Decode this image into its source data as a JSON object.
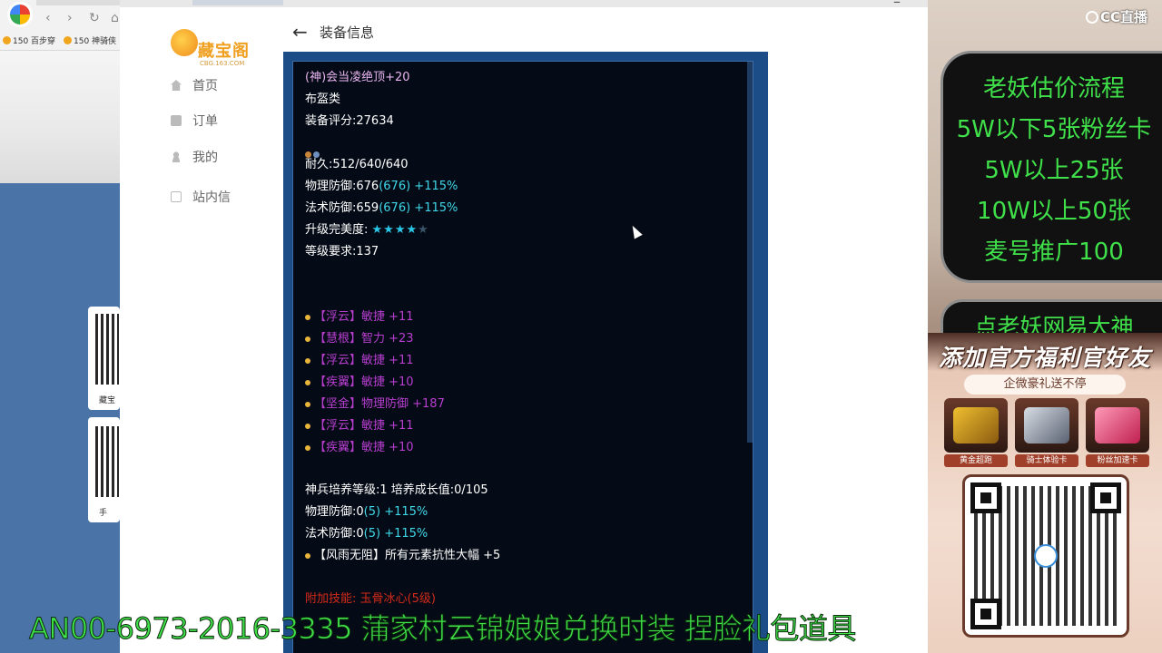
{
  "left_browser": {
    "bookmarks": [
      "150 百步穿",
      "150 神骑侠"
    ],
    "qr_cards": [
      {
        "label": "藏宝"
      },
      {
        "label": "手"
      }
    ]
  },
  "site": {
    "logo_text": "藏宝阁",
    "logo_sub": "CBG.163.COM",
    "nav": [
      {
        "label": "首页",
        "icon": "home-icon"
      },
      {
        "label": "订单",
        "icon": "order-icon"
      },
      {
        "label": "我的",
        "icon": "user-icon"
      },
      {
        "label": "站内信",
        "icon": "mail-icon"
      }
    ],
    "page_title": "装备信息"
  },
  "equipment": {
    "name": "(神)会当凌绝顶+20",
    "category": "布盔类",
    "score": "装备评分:27634",
    "durability": "耐久:512/640/640",
    "phys_def": {
      "base": "物理防御:676",
      "paren": "(676)",
      "bonus": " +115%"
    },
    "magic_def": {
      "base": "法术防御:659",
      "paren": "(676)",
      "bonus": " +115%"
    },
    "upgrade_label": "升级完美度: ",
    "upgrade_stars": 4,
    "upgrade_stars_max": 5,
    "level_req": "等级要求:137",
    "attributes": [
      "【浮云】敏捷 +11",
      "【慧根】智力 +23",
      "【浮云】敏捷 +11",
      "【疾翼】敏捷 +10",
      "【坚金】物理防御 +187",
      "【浮云】敏捷 +11",
      "【疾翼】敏捷 +10"
    ],
    "cultivation": "神兵培养等级:1 培养成长值:0/105",
    "phys_def2": {
      "base": "物理防御:0",
      "paren": "(5)",
      "bonus": " +115%"
    },
    "magic_def2": {
      "base": "法术防御:0",
      "paren": "(5)",
      "bonus": " +115%"
    },
    "special": "【风雨无阻】所有元素抗性大幅 +5",
    "skill": "附加技能:  玉骨冰心(5级)"
  },
  "overlay": {
    "brand": "CC直播",
    "price_lines": [
      "老妖估价流程",
      "5W以下5张粉丝卡",
      "5W以上25张",
      "10W以上50张",
      "麦号推广100"
    ],
    "price_line_extra": "点老妖网易大神",
    "promo_title": "添加官方福利官好友",
    "promo_sub": "企微豪礼送不停",
    "gifts": [
      "黄金超跑",
      "骑士体验卡",
      "粉丝加速卡"
    ]
  },
  "marquee": "AN00-6973-2016-3335 蒲家村云锦娘娘兑换时装 捏脸礼包道具",
  "colors": {
    "panel_bg": "#050b16",
    "panel_frame": "#1d4d86",
    "cyan": "#3fd7e8",
    "purple": "#b83ed0",
    "marquee_green": "#3fe04a"
  }
}
